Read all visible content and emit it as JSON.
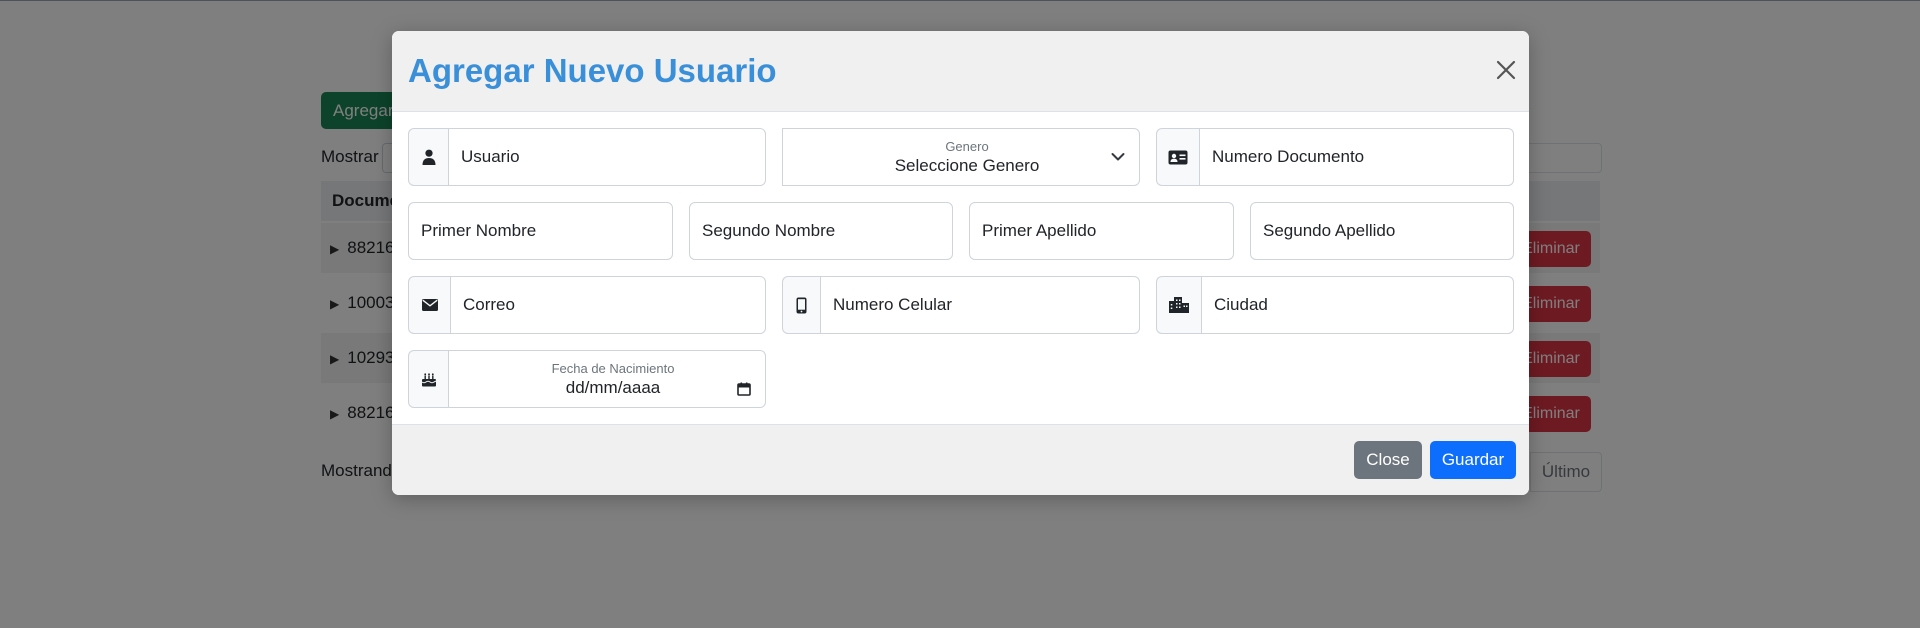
{
  "background": {
    "add_button": "Agregar Nuevo Usuario",
    "show_label": "Mostrar",
    "table_header": "Documento",
    "rows": [
      {
        "doc": "88216",
        "action": "Eliminar"
      },
      {
        "doc": "10003",
        "action": "Eliminar"
      },
      {
        "doc": "10293",
        "action": "Eliminar"
      },
      {
        "doc": "88216",
        "action": "Eliminar"
      }
    ],
    "showing_text": "Mostrando",
    "last_page": "Último"
  },
  "modal": {
    "title": "Agregar Nuevo Usuario",
    "fields": {
      "usuario": {
        "placeholder": "Usuario",
        "icon": "user-icon"
      },
      "genero": {
        "label": "Genero",
        "value": "Seleccione Genero"
      },
      "documento": {
        "placeholder": "Numero Documento",
        "icon": "id-card-icon"
      },
      "primer_nombre": {
        "placeholder": "Primer Nombre"
      },
      "segundo_nombre": {
        "placeholder": "Segundo Nombre"
      },
      "primer_apellido": {
        "placeholder": "Primer Apellido"
      },
      "segundo_apellido": {
        "placeholder": "Segundo Apellido"
      },
      "correo": {
        "placeholder": "Correo",
        "icon": "envelope-icon"
      },
      "celular": {
        "placeholder": "Numero Celular",
        "icon": "mobile-phone-icon"
      },
      "ciudad": {
        "placeholder": "Ciudad",
        "icon": "city-icon"
      },
      "nacimiento": {
        "label": "Fecha de Nacimiento",
        "value": "dd/mm/aaaa",
        "icon": "birthday-cake-icon"
      }
    },
    "buttons": {
      "close": "Close",
      "save": "Guardar"
    }
  },
  "colors": {
    "title": "#3a8fd9",
    "primary": "#0d6efd",
    "secondary": "#6c757d",
    "success": "#198754",
    "danger": "#dc3545"
  }
}
